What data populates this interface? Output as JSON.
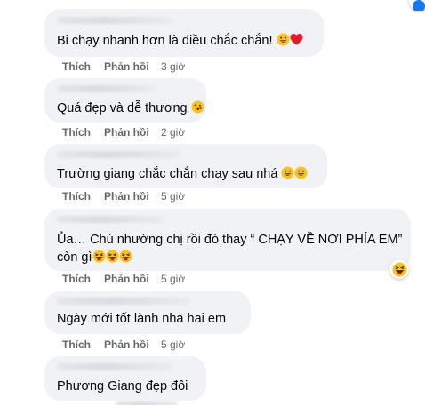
{
  "actions": {
    "like_label": "Thích",
    "reply_label": "Phản hồi"
  },
  "comments": [
    {
      "text": "Bi chạy nhanh hơn là điều chắc chắn!",
      "time": "3 giờ",
      "emojis": [
        "grinning-face",
        "red-heart"
      ]
    },
    {
      "text": "Quá đẹp và dễ thương",
      "time": "2 giờ",
      "emojis": [
        "face-blowing-kiss"
      ]
    },
    {
      "text": "Trường giang chắc chắn chạy sau nhá",
      "time": "5 giờ",
      "emojis": [
        "grinning-face",
        "grinning-face"
      ]
    },
    {
      "text": "Ủa… Chú nhường chị rồi đó thay “ CHẠY VỀ NƠI PHÍA EM” còn gì",
      "time": "5 giờ",
      "emojis": [
        "laughing-face",
        "laughing-face",
        "laughing-face"
      ],
      "reaction": "haha-reaction"
    },
    {
      "text": "Ngày mới tốt lành nha hai em",
      "time": "5 giờ",
      "emojis": []
    },
    {
      "text": "Phương Giang đẹp đôi",
      "time": "",
      "emojis": []
    }
  ],
  "colors": {
    "bubble": "#f0f2f5",
    "text": "#050505",
    "meta": "#65676b",
    "emoji_yellow": "#fcc21b",
    "heart_red": "#e4192b",
    "link_blue": "#1877f2"
  }
}
